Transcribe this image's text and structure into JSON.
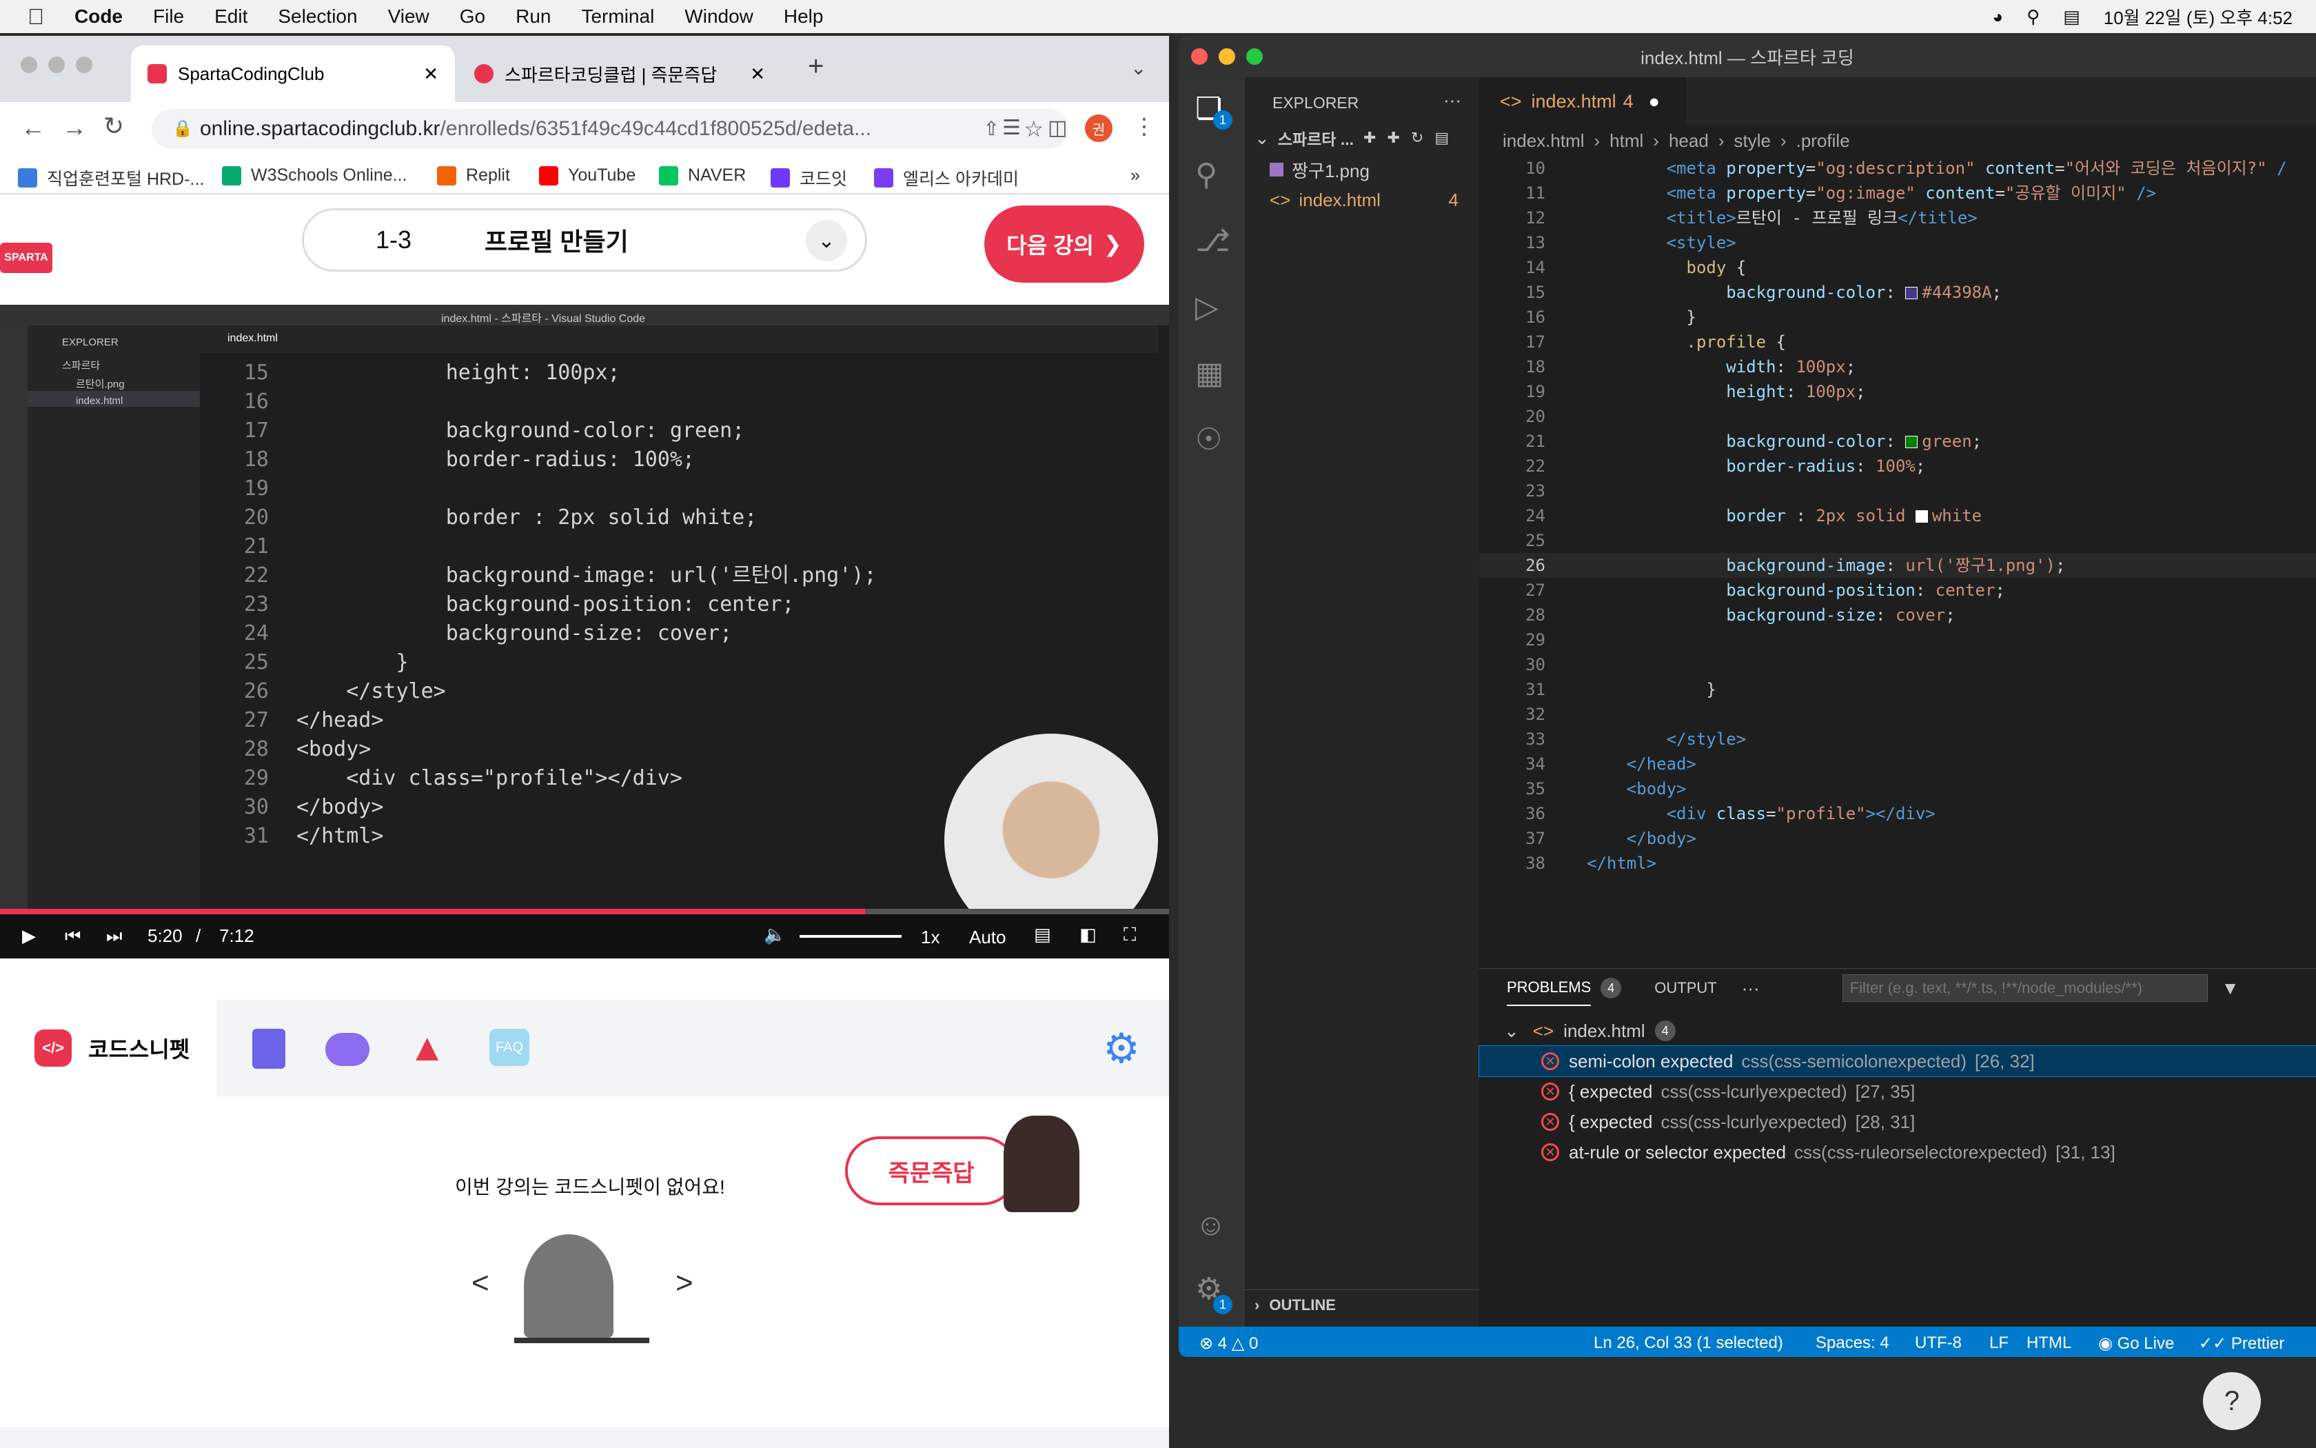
{
  "menubar": {
    "app": "Code",
    "items": [
      "File",
      "Edit",
      "Selection",
      "View",
      "Go",
      "Run",
      "Terminal",
      "Window",
      "Help"
    ],
    "datetime": "10월 22일 (토) 오후 4:52"
  },
  "chrome": {
    "tabs": [
      {
        "title": "SpartaCodingClub"
      },
      {
        "title": "스파르타코딩클럽 | 즉문즉답"
      }
    ],
    "url_host": "online.spartacodingclub.kr",
    "url_path": "/enrolleds/6351f49c49c44cd1f800525d/edeta...",
    "avatar_letter": "권",
    "bookmarks": [
      "직업훈련포털 HRD-...",
      "W3Schools Online...",
      "Replit",
      "YouTube",
      "NAVER",
      "코드잇",
      "엘리스 아카데미"
    ],
    "bookmarks_more": "»"
  },
  "lecture": {
    "logo": "SPARTA",
    "number": "1-3",
    "title": "프로필 만들기",
    "next_label": "다음 강의"
  },
  "video": {
    "window_title": "index.html - 스파르타 - Visual Studio Code",
    "explorer_label": "EXPLORER",
    "folder": "스파르타",
    "files": [
      "르탄이.png",
      "index.html"
    ],
    "tab": "index.html",
    "lines": [
      {
        "n": "15",
        "text": "            height: 100px;"
      },
      {
        "n": "16",
        "text": ""
      },
      {
        "n": "17",
        "text": "            background-color: green;"
      },
      {
        "n": "18",
        "text": "            border-radius: 100%;"
      },
      {
        "n": "19",
        "text": ""
      },
      {
        "n": "20",
        "text": "            border : 2px solid white;"
      },
      {
        "n": "21",
        "text": ""
      },
      {
        "n": "22",
        "text": "            background-image: url('르탄이.png');"
      },
      {
        "n": "23",
        "text": "            background-position: center;"
      },
      {
        "n": "24",
        "text": "            background-size: cover;"
      },
      {
        "n": "25",
        "text": "        }"
      },
      {
        "n": "26",
        "text": "    </style>"
      },
      {
        "n": "27",
        "text": "</head>"
      },
      {
        "n": "28",
        "text": "<body>"
      },
      {
        "n": "29",
        "text": "    <div class=\"profile\"></div>"
      },
      {
        "n": "30",
        "text": "</body>"
      },
      {
        "n": "31",
        "text": "</html>"
      }
    ],
    "current_time": "5:20",
    "separator": "/",
    "duration": "7:12",
    "progress": 0.74,
    "speed": "1x",
    "quality": "Auto"
  },
  "snippet": {
    "tab_label": "코드스니펫",
    "faq": "FAQ",
    "empty_message": "이번 강의는 코드스니펫이 없어요!",
    "qna_button": "즉문즉답",
    "prev": "<",
    "next": ">"
  },
  "vscode": {
    "title": "index.html — 스파르타 코딩",
    "explorer_label": "EXPLORER",
    "folder": "스파르타 ...",
    "files": [
      {
        "name": "짱구1.png",
        "badge": ""
      },
      {
        "name": "index.html",
        "badge": "4"
      }
    ],
    "outline_label": "OUTLINE",
    "tab_name": "index.html",
    "tab_badge": "4",
    "breadcrumb": [
      "index.html",
      "html",
      "head",
      "style",
      ".profile"
    ],
    "lines": [
      {
        "n": "10",
        "html": "        <span class=\"tg\">&lt;meta</span> <span class=\"at\">property</span>=<span class=\"st\">\"og:description\"</span> <span class=\"at\">content</span>=<span class=\"st\">\"어서와 코딩은 처음이지?\"</span> <span class=\"tg\">/</span>"
      },
      {
        "n": "11",
        "html": "        <span class=\"tg\">&lt;meta</span> <span class=\"at\">property</span>=<span class=\"st\">\"og:image\"</span> <span class=\"at\">content</span>=<span class=\"st\">\"공유할 이미지\"</span> <span class=\"tg\">/&gt;</span>"
      },
      {
        "n": "12",
        "html": "        <span class=\"tg\">&lt;title&gt;</span>르탄이 - 프로필 링크<span class=\"tg\">&lt;/title&gt;</span>"
      },
      {
        "n": "13",
        "html": "        <span class=\"tg\">&lt;style&gt;</span>"
      },
      {
        "n": "14",
        "html": "          <span class=\"sel\">body</span> {"
      },
      {
        "n": "15",
        "html": "              <span class=\"pr\">background-color</span>: <span class=\"sw\" style=\"background:#44398A\"></span><span class=\"vv\">#44398A</span>;"
      },
      {
        "n": "16",
        "html": "          }"
      },
      {
        "n": "17",
        "html": "          <span class=\"sel\">.profile</span> {"
      },
      {
        "n": "18",
        "html": "              <span class=\"pr\">width</span>: <span class=\"vv\">100px</span>;"
      },
      {
        "n": "19",
        "html": "              <span class=\"pr\">height</span>: <span class=\"vv\">100px</span>;"
      },
      {
        "n": "20",
        "html": ""
      },
      {
        "n": "21",
        "html": "              <span class=\"pr\">background-color</span>: <span class=\"sw\" style=\"background:green\"></span><span class=\"vv\">green</span>;"
      },
      {
        "n": "22",
        "html": "              <span class=\"pr\">border-radius</span>: <span class=\"vv\">100%</span>;"
      },
      {
        "n": "23",
        "html": ""
      },
      {
        "n": "24",
        "html": "              <span class=\"pr\">border</span> : <span class=\"vv\">2px solid</span> <span class=\"sw\" style=\"background:white\"></span><span class=\"vv\">white</span>"
      },
      {
        "n": "25",
        "html": ""
      },
      {
        "n": "26",
        "html": "              <span class=\"pr\">background-image</span>: <span class=\"vv\">url('짱구1.png')</span>;"
      },
      {
        "n": "27",
        "html": "              <span class=\"pr\">background-position</span>: <span class=\"vv\">center</span>;"
      },
      {
        "n": "28",
        "html": "              <span class=\"pr\">background-size</span>: <span class=\"vv\">cover</span>;"
      },
      {
        "n": "29",
        "html": ""
      },
      {
        "n": "30",
        "html": ""
      },
      {
        "n": "31",
        "html": "            }"
      },
      {
        "n": "32",
        "html": ""
      },
      {
        "n": "33",
        "html": "        <span class=\"tg\">&lt;/style&gt;</span>"
      },
      {
        "n": "34",
        "html": "    <span class=\"tg\">&lt;/head&gt;</span>"
      },
      {
        "n": "35",
        "html": "    <span class=\"tg\">&lt;body&gt;</span>"
      },
      {
        "n": "36",
        "html": "        <span class=\"tg\">&lt;div</span> <span class=\"at\">class</span>=<span class=\"st\">\"profile\"</span><span class=\"tg\">&gt;&lt;/div&gt;</span>"
      },
      {
        "n": "37",
        "html": "    <span class=\"tg\">&lt;/body&gt;</span>"
      },
      {
        "n": "38",
        "html": "<span class=\"tg\">&lt;/html&gt;</span>"
      }
    ],
    "panel": {
      "tabs": [
        "PROBLEMS",
        "OUTPUT"
      ],
      "problems_count": "4",
      "more": "···",
      "filter_placeholder": "Filter (e.g. text, **/*.ts, !**/node_modules/**)",
      "file": "index.html",
      "file_count": "4",
      "problems": [
        {
          "msg": "semi-colon expected",
          "src": "css(css-semicolonexpected)",
          "pos": "[26, 32]"
        },
        {
          "msg": "{ expected",
          "src": "css(css-lcurlyexpected)",
          "pos": "[27, 35]"
        },
        {
          "msg": "{ expected",
          "src": "css(css-lcurlyexpected)",
          "pos": "[28, 31]"
        },
        {
          "msg": "at-rule or selector expected",
          "src": "css(css-ruleorselectorexpected)",
          "pos": "[31, 13]"
        }
      ]
    },
    "status": {
      "errors": "4",
      "warnings": "0",
      "position": "Ln 26, Col 33 (1 selected)",
      "spaces": "Spaces: 4",
      "encoding": "UTF-8",
      "eol": "LF",
      "language": "HTML",
      "golive": "Go Live",
      "prettier": "Prettier"
    },
    "badge_explorer": "1",
    "badge_settings": "1"
  },
  "help": "?",
  "colors": {
    "accent": "#e8344e",
    "vscode_blue": "#007acc",
    "error": "#f14c4c"
  }
}
